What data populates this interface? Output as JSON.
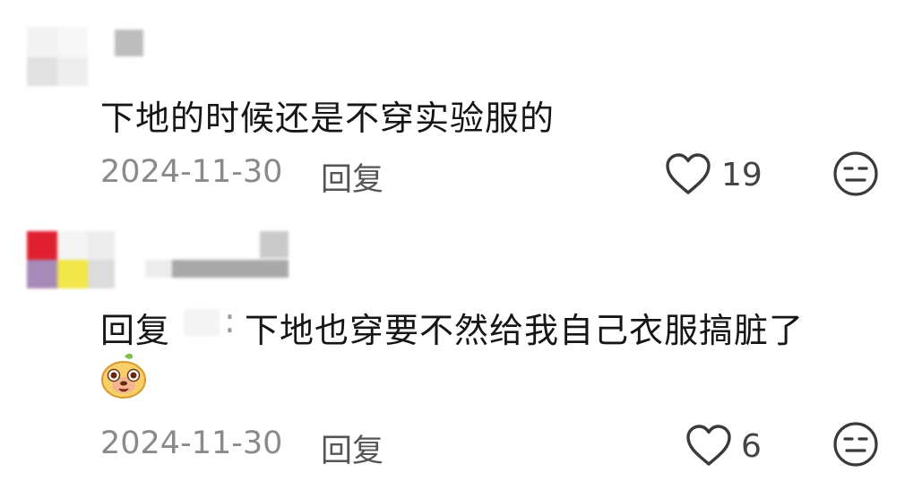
{
  "comments": [
    {
      "text": "下地的时候还是不穿实验服的",
      "date": "2024-11-30",
      "reply_label": "回复",
      "likes": "19",
      "like_icon": "heart-outline-icon",
      "reaction_icon": "neutral-face-icon"
    },
    {
      "reply_prefix": "回复",
      "separator": ":",
      "text": "下地也穿要不然给我自己衣服搞脏了",
      "emoji": "pig-sticker-icon",
      "date": "2024-11-30",
      "reply_label": "回复",
      "likes": "6",
      "like_icon": "heart-outline-icon",
      "reaction_icon": "neutral-face-icon"
    }
  ]
}
